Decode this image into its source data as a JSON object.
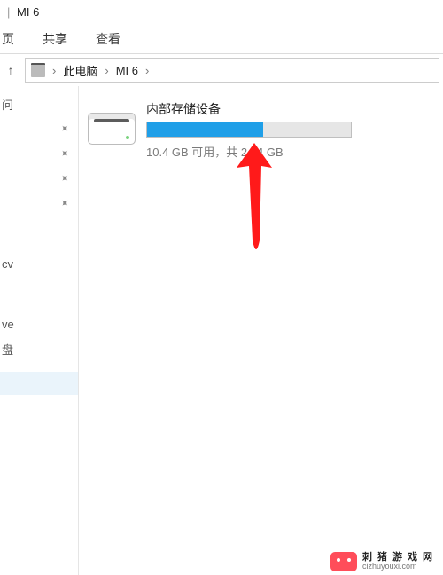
{
  "window": {
    "title_tail": "MI 6",
    "separator": "|"
  },
  "ribbon": {
    "tabs": [
      "页",
      "共享",
      "查看"
    ]
  },
  "addressbar": {
    "up_tooltip": "↑",
    "crumbs": [
      "此电脑",
      "MI 6"
    ]
  },
  "sidebar": {
    "items": [
      {
        "label": "问",
        "pin": false
      },
      {
        "label": "",
        "pin": true
      },
      {
        "label": "",
        "pin": true
      },
      {
        "label": "",
        "pin": true
      },
      {
        "label": "",
        "pin": true
      },
      {
        "label": "cv",
        "pin": false
      },
      {
        "label": "ve",
        "pin": false
      },
      {
        "label": "盘",
        "pin": false
      }
    ]
  },
  "drive": {
    "name": "内部存储设备",
    "used_fraction_percent": 57,
    "subtitle": "10.4 GB 可用，共 24.4 GB"
  },
  "watermark": {
    "text": "刺猪游戏网",
    "url": "cizhuyouxi.com"
  }
}
